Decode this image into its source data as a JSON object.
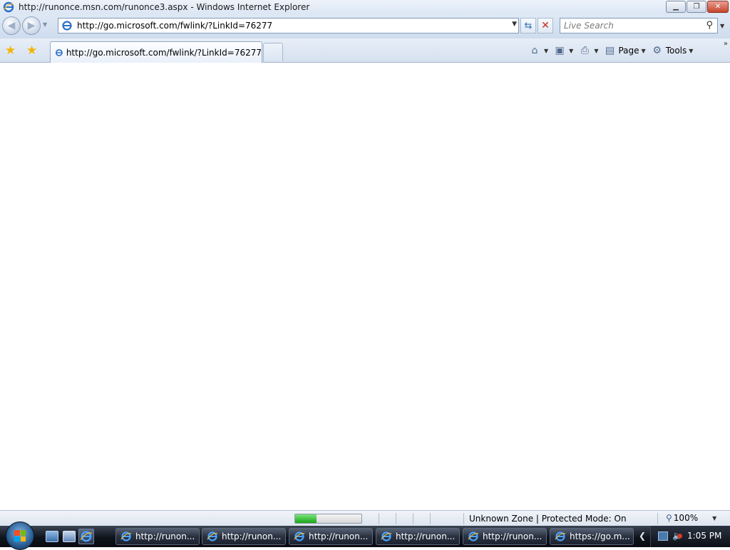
{
  "window": {
    "title": "http://runonce.msn.com/runonce3.aspx - Windows Internet Explorer",
    "minimize_icon": "minimize-icon",
    "restore_icon": "restore-icon",
    "close_icon": "close-icon"
  },
  "nav": {
    "back_icon": "back-arrow-icon",
    "forward_icon": "forward-arrow-icon",
    "address_value": "http://go.microsoft.com/fwlink/?LinkId=76277",
    "search_placeholder": "Live Search"
  },
  "tabs": [
    {
      "label": "http://go.microsoft.com/fwlink/?LinkId=76277",
      "active": true
    }
  ],
  "commandbar": {
    "page_label": "Page",
    "tools_label": "Tools"
  },
  "status": {
    "zone_text": "Unknown Zone | Protected Mode: On",
    "zoom_text": "100%",
    "progress_fraction": 0.32
  },
  "taskbar": {
    "buttons": [
      {
        "label": "http://runon..."
      },
      {
        "label": "http://runon..."
      },
      {
        "label": "http://runon..."
      },
      {
        "label": "http://runon..."
      },
      {
        "label": "http://runon..."
      },
      {
        "label": "https://go.m..."
      }
    ],
    "clock": "1:05 PM"
  },
  "colors": {
    "ie_blue": "#2b6fc9",
    "progress_green": "#1ba51b",
    "close_red": "#c7432c"
  }
}
